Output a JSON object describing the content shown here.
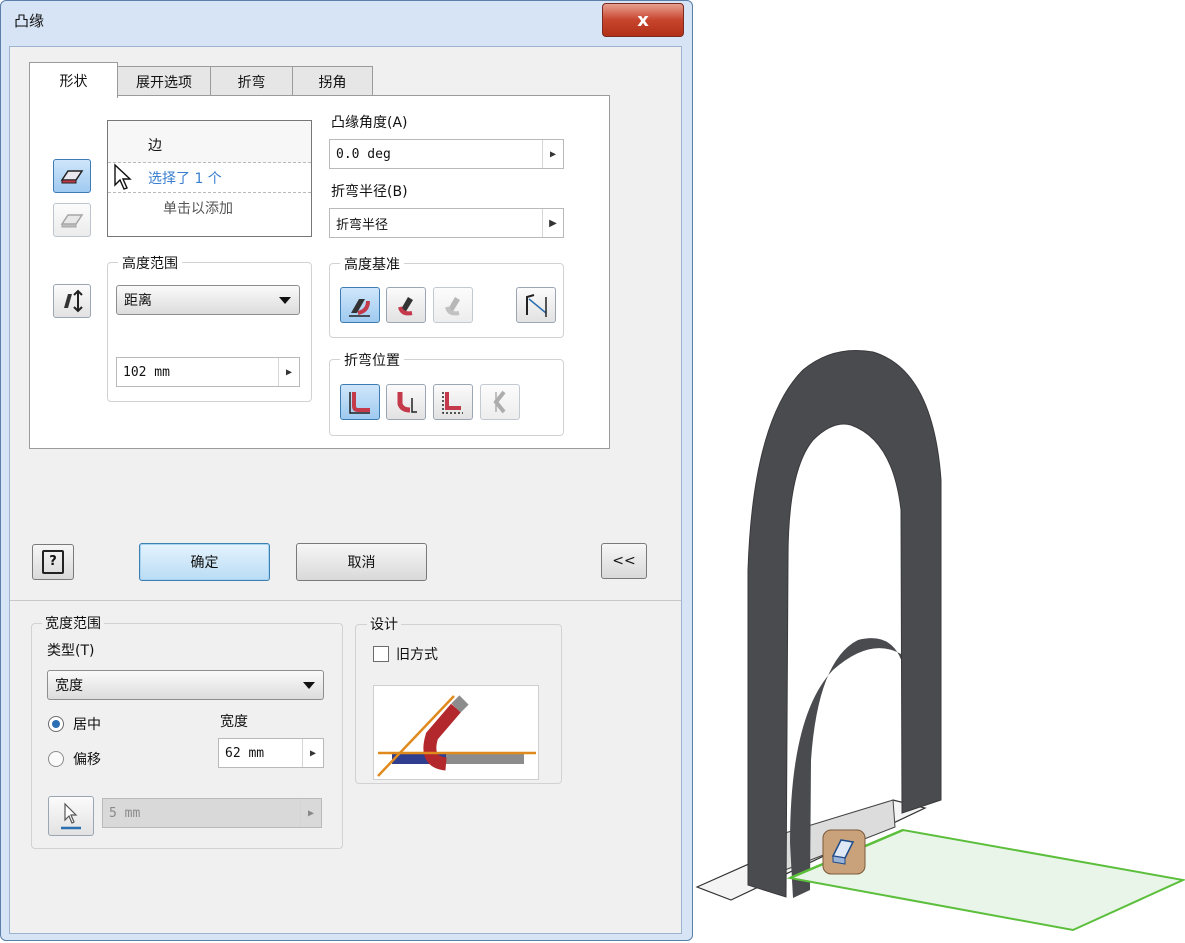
{
  "dialog": {
    "title": "凸缘",
    "close_label": "x",
    "tabs": [
      "形状",
      "展开选项",
      "折弯",
      "拐角"
    ],
    "edges": {
      "header": "边",
      "selected": "选择了 1 个",
      "add_hint": "单击以添加"
    },
    "flange_angle": {
      "label": "凸缘角度(A)",
      "value": "0.0 deg"
    },
    "bend_radius": {
      "label": "折弯半径(B)",
      "value": "折弯半径"
    },
    "height_extent": {
      "label": "高度范围",
      "type": "距离",
      "value": "102 mm"
    },
    "height_datum": {
      "label": "高度基准"
    },
    "bend_position": {
      "label": "折弯位置"
    },
    "buttons": {
      "help": "?",
      "ok": "确定",
      "cancel": "取消",
      "more": "<<"
    },
    "width_extent": {
      "label": "宽度范围",
      "type_label": "类型(T)",
      "type_value": "宽度",
      "radio_centered": "居中",
      "radio_offset": "偏移",
      "width_label": "宽度",
      "width_value": "62 mm",
      "offset_value": "5 mm"
    },
    "design": {
      "label": "设计",
      "old_style": "旧方式"
    }
  },
  "colors": {
    "window_frame": "#d6e4f5",
    "close_button": "#c7442d",
    "selection_blue": "#3d7bb5",
    "model_dark": "#4a4b4f",
    "model_edge_green": "#5bbf3c"
  }
}
